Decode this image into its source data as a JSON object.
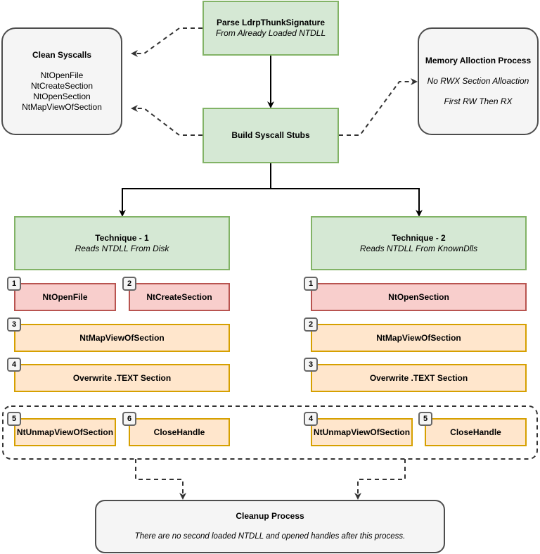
{
  "top": {
    "title": "Parse LdrpThunkSignature",
    "subtitle": "From Already Loaded NTDLL"
  },
  "build": {
    "title": "Build Syscall Stubs"
  },
  "clean_syscalls": {
    "title": "Clean Syscalls",
    "items": [
      "NtOpenFile",
      "NtCreateSection",
      "NtOpenSection",
      "NtMapViewOfSection"
    ]
  },
  "memory": {
    "title": "Memory Alloction Process",
    "line1": "No RWX Section Alloaction",
    "line2": "First RW Then RX"
  },
  "technique1": {
    "title": "Technique - 1",
    "subtitle": "Reads NTDLL From Disk",
    "steps": [
      {
        "num": "1",
        "label": "NtOpenFile"
      },
      {
        "num": "2",
        "label": "NtCreateSection"
      },
      {
        "num": "3",
        "label": "NtMapViewOfSection"
      },
      {
        "num": "4",
        "label": "Overwrite .TEXT Section"
      },
      {
        "num": "5",
        "label": "NtUnmapViewOfSection"
      },
      {
        "num": "6",
        "label": "CloseHandle"
      }
    ]
  },
  "technique2": {
    "title": "Technique - 2",
    "subtitle": "Reads NTDLL From KnownDlls",
    "steps": [
      {
        "num": "1",
        "label": "NtOpenSection"
      },
      {
        "num": "2",
        "label": "NtMapViewOfSection"
      },
      {
        "num": "3",
        "label": "Overwrite .TEXT Section"
      },
      {
        "num": "4",
        "label": "NtUnmapViewOfSection"
      },
      {
        "num": "5",
        "label": "CloseHandle"
      }
    ]
  },
  "cleanup": {
    "title": "Cleanup Process",
    "description": "There are no second loaded NTDLL and opened handles after this process."
  },
  "colors": {
    "process_fill": "#d5e8d4",
    "process_stroke": "#82b366",
    "open_fill": "#f8cecc",
    "open_stroke": "#b85450",
    "step_fill": "#ffe6cc",
    "step_stroke": "#d6a000",
    "note_fill": "#f5f5f5",
    "note_stroke": "#4d4d4d"
  }
}
